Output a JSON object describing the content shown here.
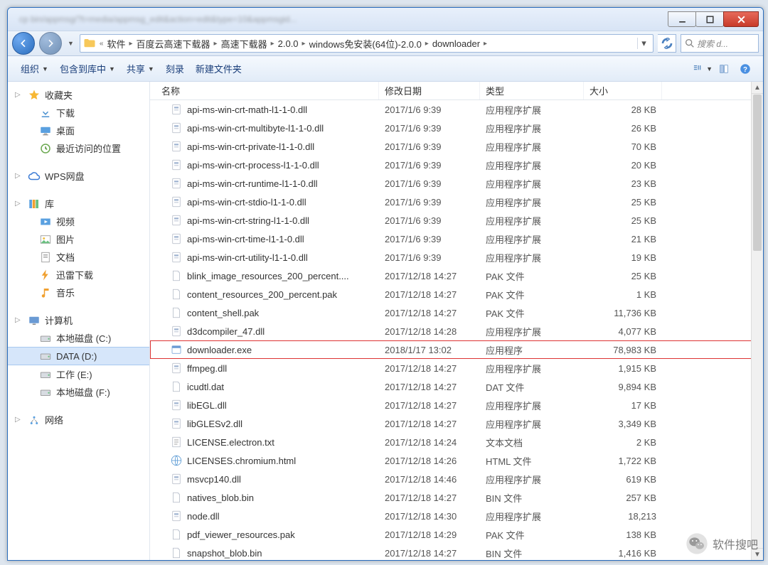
{
  "window": {
    "title_blur": "cp bin/appmsg/?t=media/appmsg_edit&action=edit&type=10&appmsgid...",
    "min": "—",
    "max": "□",
    "close": "✕"
  },
  "nav": {
    "back": "←",
    "fwd": "→"
  },
  "breadcrumb": {
    "prefix": "«",
    "items": [
      "软件",
      "百度云高速下载器",
      "高速下载器",
      "2.0.0",
      "windows免安装(64位)-2.0.0",
      "downloader"
    ]
  },
  "search": {
    "placeholder": "搜索 d..."
  },
  "toolbar": {
    "organize": "组织",
    "include": "包含到库中",
    "share": "共享",
    "burn": "刻录",
    "newfolder": "新建文件夹"
  },
  "sidebar": {
    "favorites": {
      "label": "收藏夹",
      "items": [
        "下载",
        "桌面",
        "最近访问的位置"
      ]
    },
    "wps": {
      "label": "WPS网盘"
    },
    "libraries": {
      "label": "库",
      "items": [
        "视频",
        "图片",
        "文档",
        "迅雷下载",
        "音乐"
      ]
    },
    "computer": {
      "label": "计算机",
      "items": [
        "本地磁盘 (C:)",
        "DATA (D:)",
        "工作 (E:)",
        "本地磁盘 (F:)"
      ]
    },
    "network": {
      "label": "网络"
    }
  },
  "columns": {
    "name": "名称",
    "date": "修改日期",
    "type": "类型",
    "size": "大小"
  },
  "filetypes": {
    "ext": "应用程序扩展",
    "pak": "PAK 文件",
    "app": "应用程序",
    "dat": "DAT 文件",
    "txt": "文本文档",
    "html": "HTML 文件",
    "bin": "BIN 文件"
  },
  "files": [
    {
      "icon": "dll",
      "name": "api-ms-win-crt-math-l1-1-0.dll",
      "date": "2017/1/6 9:39",
      "type": "ext",
      "size": "28 KB"
    },
    {
      "icon": "dll",
      "name": "api-ms-win-crt-multibyte-l1-1-0.dll",
      "date": "2017/1/6 9:39",
      "type": "ext",
      "size": "26 KB"
    },
    {
      "icon": "dll",
      "name": "api-ms-win-crt-private-l1-1-0.dll",
      "date": "2017/1/6 9:39",
      "type": "ext",
      "size": "70 KB"
    },
    {
      "icon": "dll",
      "name": "api-ms-win-crt-process-l1-1-0.dll",
      "date": "2017/1/6 9:39",
      "type": "ext",
      "size": "20 KB"
    },
    {
      "icon": "dll",
      "name": "api-ms-win-crt-runtime-l1-1-0.dll",
      "date": "2017/1/6 9:39",
      "type": "ext",
      "size": "23 KB"
    },
    {
      "icon": "dll",
      "name": "api-ms-win-crt-stdio-l1-1-0.dll",
      "date": "2017/1/6 9:39",
      "type": "ext",
      "size": "25 KB"
    },
    {
      "icon": "dll",
      "name": "api-ms-win-crt-string-l1-1-0.dll",
      "date": "2017/1/6 9:39",
      "type": "ext",
      "size": "25 KB"
    },
    {
      "icon": "dll",
      "name": "api-ms-win-crt-time-l1-1-0.dll",
      "date": "2017/1/6 9:39",
      "type": "ext",
      "size": "21 KB"
    },
    {
      "icon": "dll",
      "name": "api-ms-win-crt-utility-l1-1-0.dll",
      "date": "2017/1/6 9:39",
      "type": "ext",
      "size": "19 KB"
    },
    {
      "icon": "file",
      "name": "blink_image_resources_200_percent....",
      "date": "2017/12/18 14:27",
      "type": "pak",
      "size": "25 KB"
    },
    {
      "icon": "file",
      "name": "content_resources_200_percent.pak",
      "date": "2017/12/18 14:27",
      "type": "pak",
      "size": "1 KB"
    },
    {
      "icon": "file",
      "name": "content_shell.pak",
      "date": "2017/12/18 14:27",
      "type": "pak",
      "size": "11,736 KB"
    },
    {
      "icon": "dll",
      "name": "d3dcompiler_47.dll",
      "date": "2017/12/18 14:28",
      "type": "ext",
      "size": "4,077 KB"
    },
    {
      "icon": "exe",
      "name": "downloader.exe",
      "date": "2018/1/17 13:02",
      "type": "app",
      "size": "78,983 KB",
      "highlight": true
    },
    {
      "icon": "dll",
      "name": "ffmpeg.dll",
      "date": "2017/12/18 14:27",
      "type": "ext",
      "size": "1,915 KB"
    },
    {
      "icon": "file",
      "name": "icudtl.dat",
      "date": "2017/12/18 14:27",
      "type": "dat",
      "size": "9,894 KB"
    },
    {
      "icon": "dll",
      "name": "libEGL.dll",
      "date": "2017/12/18 14:27",
      "type": "ext",
      "size": "17 KB"
    },
    {
      "icon": "dll",
      "name": "libGLESv2.dll",
      "date": "2017/12/18 14:27",
      "type": "ext",
      "size": "3,349 KB"
    },
    {
      "icon": "txt",
      "name": "LICENSE.electron.txt",
      "date": "2017/12/18 14:24",
      "type": "txt",
      "size": "2 KB"
    },
    {
      "icon": "html",
      "name": "LICENSES.chromium.html",
      "date": "2017/12/18 14:26",
      "type": "html",
      "size": "1,722 KB"
    },
    {
      "icon": "dll",
      "name": "msvcp140.dll",
      "date": "2017/12/18 14:46",
      "type": "ext",
      "size": "619 KB"
    },
    {
      "icon": "file",
      "name": "natives_blob.bin",
      "date": "2017/12/18 14:27",
      "type": "bin",
      "size": "257 KB"
    },
    {
      "icon": "dll",
      "name": "node.dll",
      "date": "2017/12/18 14:30",
      "type": "ext",
      "size": "18,213"
    },
    {
      "icon": "file",
      "name": "pdf_viewer_resources.pak",
      "date": "2017/12/18 14:29",
      "type": "pak",
      "size": "138 KB"
    },
    {
      "icon": "file",
      "name": "snapshot_blob.bin",
      "date": "2017/12/18 14:27",
      "type": "bin",
      "size": "1,416 KB"
    }
  ],
  "watermark": "软件搜吧"
}
